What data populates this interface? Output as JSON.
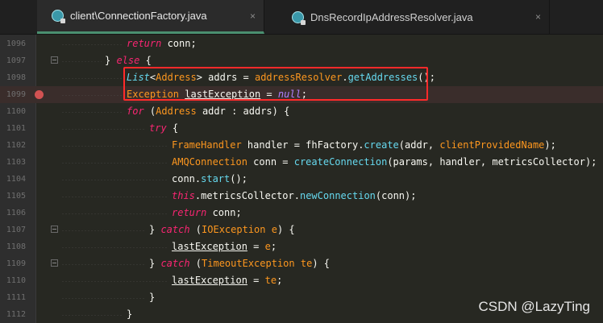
{
  "tabs": [
    {
      "label": "client\\ConnectionFactory.java",
      "close": "×",
      "active": true
    },
    {
      "label": "DnsRecordIpAddressResolver.java",
      "close": "×",
      "active": false
    }
  ],
  "lines": [
    {
      "num": "1096",
      "parts": [
        [
          "k",
          "return"
        ],
        [
          "v",
          " conn;"
        ]
      ]
    },
    {
      "num": "1097",
      "parts": [
        [
          "v",
          "} "
        ],
        [
          "k",
          "else"
        ],
        [
          "v",
          " {"
        ]
      ]
    },
    {
      "num": "1098",
      "parts": [
        [
          "t",
          "List"
        ],
        [
          "o",
          "<"
        ],
        [
          "c",
          "Address"
        ],
        [
          "o",
          "> "
        ],
        [
          "v",
          "addrs = "
        ],
        [
          "c",
          "addressResolver"
        ],
        [
          "o",
          "."
        ],
        [
          "m",
          "getAddresses"
        ],
        [
          "v",
          "();"
        ]
      ]
    },
    {
      "num": "1099",
      "parts": [
        [
          "c",
          "Exception "
        ],
        [
          "u",
          "lastException"
        ],
        [
          "v",
          " = "
        ],
        [
          "i",
          "null"
        ],
        [
          "v",
          ";"
        ]
      ]
    },
    {
      "num": "1100",
      "parts": [
        [
          "k",
          "for"
        ],
        [
          "v",
          " ("
        ],
        [
          "c",
          "Address"
        ],
        [
          "v",
          " addr : addrs) {"
        ]
      ]
    },
    {
      "num": "1101",
      "parts": [
        [
          "k",
          "try"
        ],
        [
          "v",
          " {"
        ]
      ]
    },
    {
      "num": "1102",
      "parts": [
        [
          "c",
          "FrameHandler"
        ],
        [
          "v",
          " handler = fhFactory."
        ],
        [
          "m",
          "create"
        ],
        [
          "v",
          "(addr, "
        ],
        [
          "p",
          "clientProvidedName"
        ],
        [
          "v",
          ");"
        ]
      ]
    },
    {
      "num": "1103",
      "parts": [
        [
          "c",
          "AMQConnection"
        ],
        [
          "v",
          " conn = "
        ],
        [
          "m",
          "createConnection"
        ],
        [
          "v",
          "(params, handler, metricsCollector);"
        ]
      ]
    },
    {
      "num": "1104",
      "parts": [
        [
          "v",
          "conn."
        ],
        [
          "m",
          "start"
        ],
        [
          "v",
          "();"
        ]
      ]
    },
    {
      "num": "1105",
      "parts": [
        [
          "k",
          "this"
        ],
        [
          "v",
          "."
        ],
        [
          "v",
          "metricsCollector"
        ],
        [
          "v",
          "."
        ],
        [
          "m",
          "newConnection"
        ],
        [
          "v",
          "(conn);"
        ]
      ]
    },
    {
      "num": "1106",
      "parts": [
        [
          "k",
          "return"
        ],
        [
          "v",
          " conn;"
        ]
      ]
    },
    {
      "num": "1107",
      "parts": [
        [
          "v",
          "} "
        ],
        [
          "k",
          "catch"
        ],
        [
          "v",
          " ("
        ],
        [
          "c",
          "IOException"
        ],
        [
          "v",
          " "
        ],
        [
          "p",
          "e"
        ],
        [
          "v",
          ") {"
        ]
      ]
    },
    {
      "num": "1108",
      "parts": [
        [
          "u",
          "lastException"
        ],
        [
          "v",
          " = "
        ],
        [
          "p",
          "e"
        ],
        [
          "v",
          ";"
        ]
      ]
    },
    {
      "num": "1109",
      "parts": [
        [
          "v",
          "} "
        ],
        [
          "k",
          "catch"
        ],
        [
          "v",
          " ("
        ],
        [
          "c",
          "TimeoutException"
        ],
        [
          "v",
          " "
        ],
        [
          "p",
          "te"
        ],
        [
          "v",
          ") {"
        ]
      ]
    },
    {
      "num": "1110",
      "parts": [
        [
          "u",
          "lastException"
        ],
        [
          "v",
          " = "
        ],
        [
          "p",
          "te"
        ],
        [
          "v",
          ";"
        ]
      ]
    },
    {
      "num": "1111",
      "parts": [
        [
          "v",
          "}"
        ]
      ]
    },
    {
      "num": "1112",
      "parts": [
        [
          "v",
          "}"
        ]
      ]
    }
  ],
  "watermark": "CSDN @LazyTing"
}
